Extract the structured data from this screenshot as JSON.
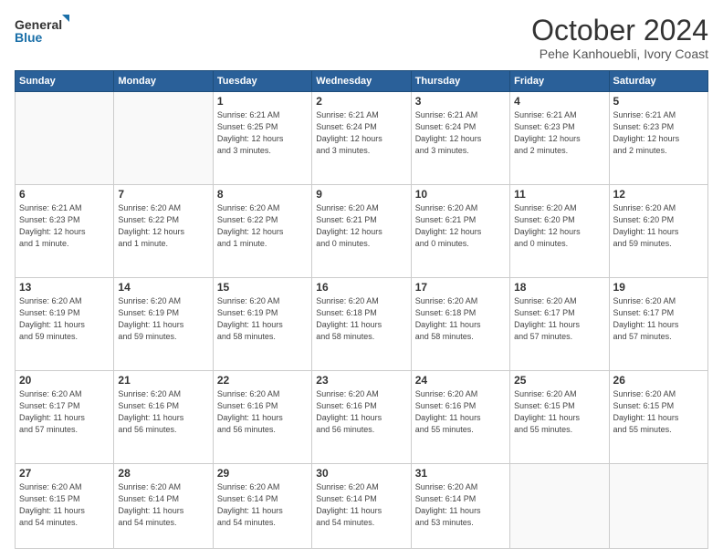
{
  "logo": {
    "line1": "General",
    "line2": "Blue"
  },
  "title": "October 2024",
  "location": "Pehe Kanhouebli, Ivory Coast",
  "days_header": [
    "Sunday",
    "Monday",
    "Tuesday",
    "Wednesday",
    "Thursday",
    "Friday",
    "Saturday"
  ],
  "weeks": [
    [
      {
        "day": "",
        "info": ""
      },
      {
        "day": "",
        "info": ""
      },
      {
        "day": "1",
        "info": "Sunrise: 6:21 AM\nSunset: 6:25 PM\nDaylight: 12 hours\nand 3 minutes."
      },
      {
        "day": "2",
        "info": "Sunrise: 6:21 AM\nSunset: 6:24 PM\nDaylight: 12 hours\nand 3 minutes."
      },
      {
        "day": "3",
        "info": "Sunrise: 6:21 AM\nSunset: 6:24 PM\nDaylight: 12 hours\nand 3 minutes."
      },
      {
        "day": "4",
        "info": "Sunrise: 6:21 AM\nSunset: 6:23 PM\nDaylight: 12 hours\nand 2 minutes."
      },
      {
        "day": "5",
        "info": "Sunrise: 6:21 AM\nSunset: 6:23 PM\nDaylight: 12 hours\nand 2 minutes."
      }
    ],
    [
      {
        "day": "6",
        "info": "Sunrise: 6:21 AM\nSunset: 6:23 PM\nDaylight: 12 hours\nand 1 minute."
      },
      {
        "day": "7",
        "info": "Sunrise: 6:20 AM\nSunset: 6:22 PM\nDaylight: 12 hours\nand 1 minute."
      },
      {
        "day": "8",
        "info": "Sunrise: 6:20 AM\nSunset: 6:22 PM\nDaylight: 12 hours\nand 1 minute."
      },
      {
        "day": "9",
        "info": "Sunrise: 6:20 AM\nSunset: 6:21 PM\nDaylight: 12 hours\nand 0 minutes."
      },
      {
        "day": "10",
        "info": "Sunrise: 6:20 AM\nSunset: 6:21 PM\nDaylight: 12 hours\nand 0 minutes."
      },
      {
        "day": "11",
        "info": "Sunrise: 6:20 AM\nSunset: 6:20 PM\nDaylight: 12 hours\nand 0 minutes."
      },
      {
        "day": "12",
        "info": "Sunrise: 6:20 AM\nSunset: 6:20 PM\nDaylight: 11 hours\nand 59 minutes."
      }
    ],
    [
      {
        "day": "13",
        "info": "Sunrise: 6:20 AM\nSunset: 6:19 PM\nDaylight: 11 hours\nand 59 minutes."
      },
      {
        "day": "14",
        "info": "Sunrise: 6:20 AM\nSunset: 6:19 PM\nDaylight: 11 hours\nand 59 minutes."
      },
      {
        "day": "15",
        "info": "Sunrise: 6:20 AM\nSunset: 6:19 PM\nDaylight: 11 hours\nand 58 minutes."
      },
      {
        "day": "16",
        "info": "Sunrise: 6:20 AM\nSunset: 6:18 PM\nDaylight: 11 hours\nand 58 minutes."
      },
      {
        "day": "17",
        "info": "Sunrise: 6:20 AM\nSunset: 6:18 PM\nDaylight: 11 hours\nand 58 minutes."
      },
      {
        "day": "18",
        "info": "Sunrise: 6:20 AM\nSunset: 6:17 PM\nDaylight: 11 hours\nand 57 minutes."
      },
      {
        "day": "19",
        "info": "Sunrise: 6:20 AM\nSunset: 6:17 PM\nDaylight: 11 hours\nand 57 minutes."
      }
    ],
    [
      {
        "day": "20",
        "info": "Sunrise: 6:20 AM\nSunset: 6:17 PM\nDaylight: 11 hours\nand 57 minutes."
      },
      {
        "day": "21",
        "info": "Sunrise: 6:20 AM\nSunset: 6:16 PM\nDaylight: 11 hours\nand 56 minutes."
      },
      {
        "day": "22",
        "info": "Sunrise: 6:20 AM\nSunset: 6:16 PM\nDaylight: 11 hours\nand 56 minutes."
      },
      {
        "day": "23",
        "info": "Sunrise: 6:20 AM\nSunset: 6:16 PM\nDaylight: 11 hours\nand 56 minutes."
      },
      {
        "day": "24",
        "info": "Sunrise: 6:20 AM\nSunset: 6:16 PM\nDaylight: 11 hours\nand 55 minutes."
      },
      {
        "day": "25",
        "info": "Sunrise: 6:20 AM\nSunset: 6:15 PM\nDaylight: 11 hours\nand 55 minutes."
      },
      {
        "day": "26",
        "info": "Sunrise: 6:20 AM\nSunset: 6:15 PM\nDaylight: 11 hours\nand 55 minutes."
      }
    ],
    [
      {
        "day": "27",
        "info": "Sunrise: 6:20 AM\nSunset: 6:15 PM\nDaylight: 11 hours\nand 54 minutes."
      },
      {
        "day": "28",
        "info": "Sunrise: 6:20 AM\nSunset: 6:14 PM\nDaylight: 11 hours\nand 54 minutes."
      },
      {
        "day": "29",
        "info": "Sunrise: 6:20 AM\nSunset: 6:14 PM\nDaylight: 11 hours\nand 54 minutes."
      },
      {
        "day": "30",
        "info": "Sunrise: 6:20 AM\nSunset: 6:14 PM\nDaylight: 11 hours\nand 54 minutes."
      },
      {
        "day": "31",
        "info": "Sunrise: 6:20 AM\nSunset: 6:14 PM\nDaylight: 11 hours\nand 53 minutes."
      },
      {
        "day": "",
        "info": ""
      },
      {
        "day": "",
        "info": ""
      }
    ]
  ]
}
